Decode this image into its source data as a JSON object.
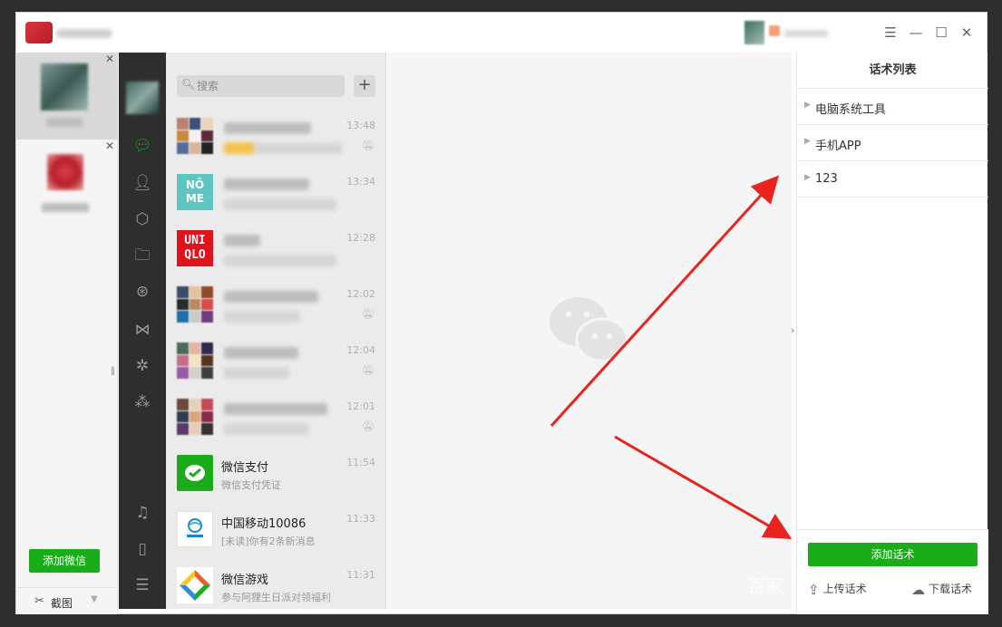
{
  "window": {
    "controls": [
      "☰",
      "—",
      "☐",
      "✕"
    ]
  },
  "accounts": {
    "add_button": "添加微信",
    "screenshot_label": "截图"
  },
  "search": {
    "placeholder": "搜索"
  },
  "chats": [
    {
      "name": "",
      "preview": "",
      "time": "13:48",
      "muted": true
    },
    {
      "name": "",
      "preview": "",
      "time": "13:34",
      "muted": false
    },
    {
      "name": "",
      "preview": "",
      "time": "12:28",
      "muted": false
    },
    {
      "name": "",
      "preview": "",
      "time": "12:02",
      "muted": true
    },
    {
      "name": "",
      "preview": "",
      "time": "12:04",
      "muted": true
    },
    {
      "name": "",
      "preview": "",
      "time": "12:01",
      "muted": true
    },
    {
      "name": "微信支付",
      "preview": "微信支付凭证",
      "time": "11:54",
      "muted": false
    },
    {
      "name": "中国移动10086",
      "preview": "[未读]你有2条新消息",
      "time": "11:33",
      "muted": false
    },
    {
      "name": "微信游戏",
      "preview": "参与阿狸生日派对领福利",
      "time": "11:31",
      "muted": false
    }
  ],
  "avatar_labels": {
    "nome": "NŌ ME",
    "uniqlo_top": "UNI",
    "uniqlo_bottom": "QLO"
  },
  "right_panel": {
    "title": "话术列表",
    "items": [
      "电脑系统工具",
      "手机APP",
      "123"
    ],
    "add_button": "添加话术",
    "upload": "上传话术",
    "download": "下载话术"
  },
  "watermark": "百家",
  "colors": {
    "wechat_green": "#1aad19",
    "nav_dark": "#2e2e2e",
    "arrow_red": "#e8241e"
  }
}
